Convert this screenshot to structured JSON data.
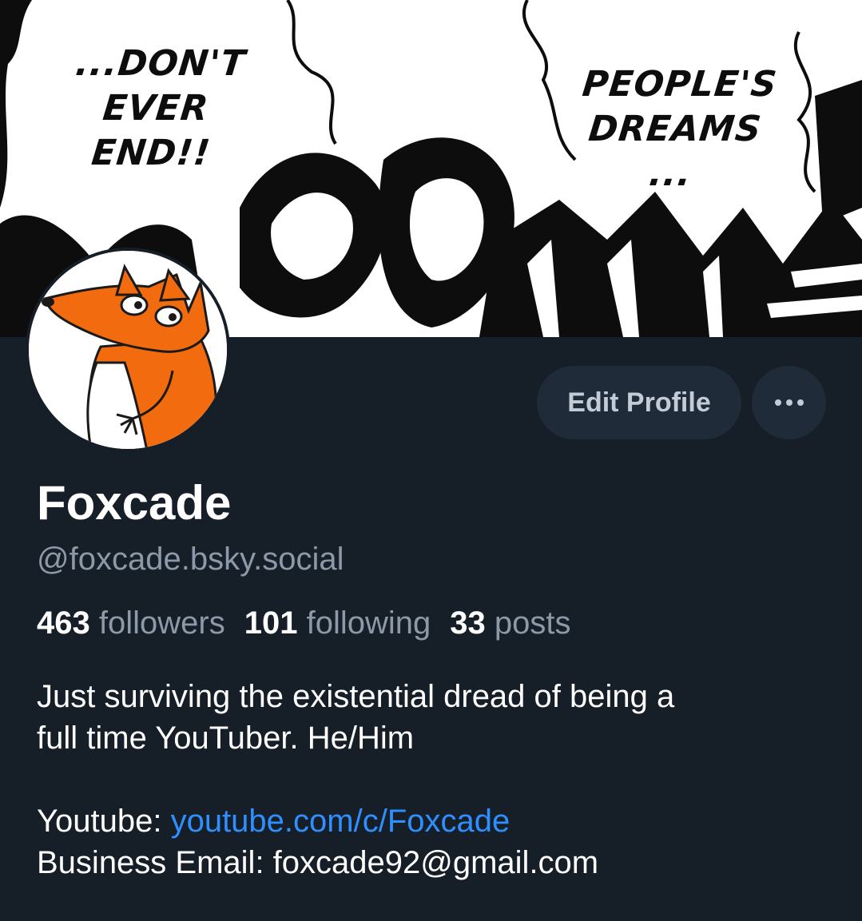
{
  "banner": {
    "bubble_left_lines": [
      "...DON'T",
      "EVER",
      "END!!"
    ],
    "bubble_right_lines": [
      "PEOPLE'S",
      "DREAMS",
      "..."
    ]
  },
  "avatar_icon": "fox-avatar",
  "actions": {
    "edit_label": "Edit Profile",
    "more_icon": "ellipsis-icon"
  },
  "profile": {
    "display_name": "Foxcade",
    "handle": "@foxcade.bsky.social"
  },
  "stats": {
    "followers_count": "463",
    "followers_label": "followers",
    "following_count": "101",
    "following_label": "following",
    "posts_count": "33",
    "posts_label": "posts"
  },
  "bio": {
    "line1": "Just surviving the existential dread of being a",
    "line2": "full time YouTuber. He/Him",
    "youtube_label": "Youtube: ",
    "youtube_link": "youtube.com/c/Foxcade",
    "email_line": "Business Email: foxcade92@gmail.com"
  },
  "colors": {
    "background": "#161e27",
    "button_bg": "#1f2b38",
    "link": "#2f8fff",
    "muted_text": "#8c99a8"
  }
}
